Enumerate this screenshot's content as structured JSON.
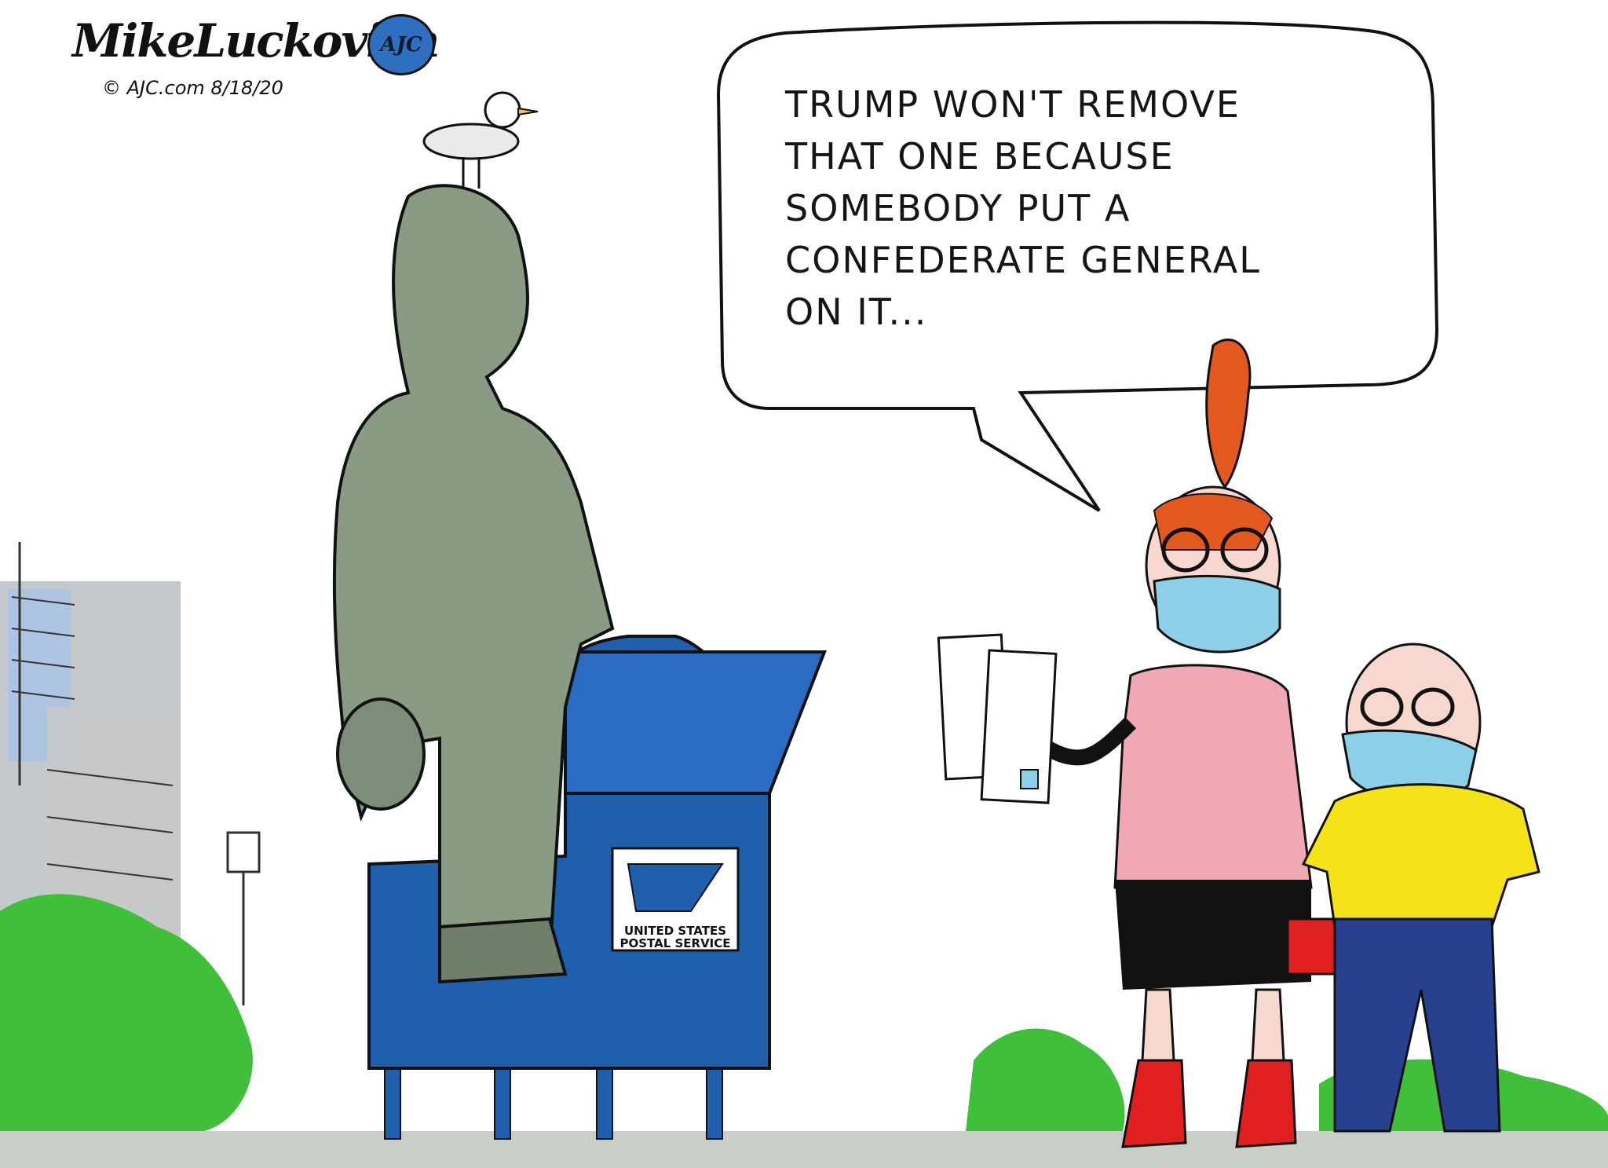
{
  "cartoon": {
    "signature": "MikeLuckovich",
    "credit": "© AJC.com 8/18/20",
    "badge": "AJC"
  },
  "speech_bubble": {
    "lines": [
      "TRUMP WON'T REMOVE",
      "THAT ONE BECAUSE",
      "SOMEBODY PUT A",
      "CONFEDERATE GENERAL",
      "ON IT..."
    ]
  },
  "mailbox": {
    "label_line1": "UNITED STATES",
    "label_line2": "POSTAL SERVICE"
  },
  "colors": {
    "mailbox_blue": "#1f5fae",
    "statue_green": "#8a9b84",
    "shirt_pink": "#f0a8b4",
    "shirt_yellow": "#f4e316",
    "bush_green": "#3fbf3a",
    "hair_red": "#e2581f",
    "mask_blue": "#8ccfe6"
  }
}
